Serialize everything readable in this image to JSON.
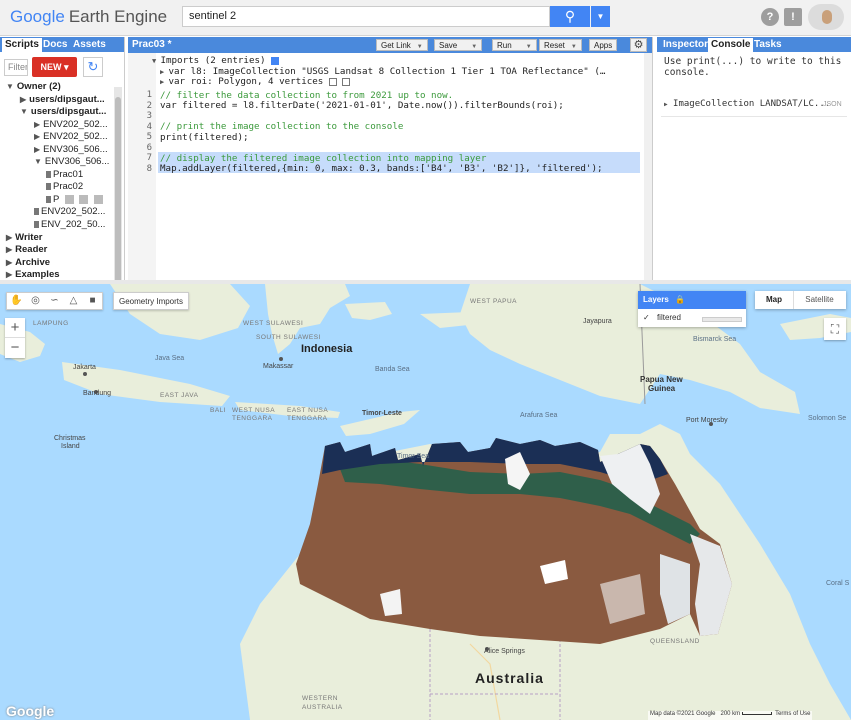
{
  "app": {
    "logo_google": "Google",
    "logo_product": "Earth Engine"
  },
  "search": {
    "value": "sentinel 2",
    "icon": "search-icon"
  },
  "topbar": {
    "help_icon": "?",
    "feedback_icon": "!",
    "apps_icon": "⋮"
  },
  "left_panel": {
    "tabs": [
      "Scripts",
      "Docs",
      "Assets"
    ],
    "filter_placeholder": "Filter",
    "new_label": "NEW",
    "tree": [
      {
        "label": "Owner (2)",
        "bold": true,
        "arrow": "▼"
      },
      {
        "label": "users/dipsgaut...",
        "bold": true,
        "arrow": "▶"
      },
      {
        "label": "users/dipsgaut...",
        "bold": true,
        "arrow": "▼"
      },
      {
        "label": "ENV202_502...",
        "arrow": "▶"
      },
      {
        "label": "ENV202_502...",
        "arrow": "▶"
      },
      {
        "label": "ENV306_506...",
        "arrow": "▶"
      },
      {
        "label": "ENV306_506...",
        "arrow": "▼"
      },
      {
        "label": "Prac01",
        "file": true
      },
      {
        "label": "Prac02",
        "file": true
      },
      {
        "label": "P",
        "file": true
      },
      {
        "label": "ENV202_502...",
        "file": true
      },
      {
        "label": "ENV_202_50...",
        "file": true
      },
      {
        "label": "Writer",
        "bold": true,
        "arrow": "▶"
      },
      {
        "label": "Reader",
        "bold": true,
        "arrow": "▶"
      },
      {
        "label": "Archive",
        "bold": true,
        "arrow": "▶"
      },
      {
        "label": "Examples",
        "bold": true,
        "arrow": "▶"
      }
    ]
  },
  "editor": {
    "title": "Prac03 *",
    "buttons": {
      "get_link": "Get Link",
      "save": "Save",
      "run": "Run",
      "reset": "Reset",
      "apps": "Apps"
    },
    "imports_header": "Imports (2 entries)",
    "imports": [
      "var l8: ImageCollection \"USGS Landsat 8 Collection 1 Tier 1 TOA Reflectance\" (…",
      "var roi: Polygon, 4 vertices"
    ],
    "line_numbers": [
      "1",
      "2",
      "3",
      "4",
      "5",
      "6",
      "7",
      "8"
    ],
    "lines": [
      "// filter the data collection to from 2021 up to now.",
      "var filtered = l8.filterDate('2021-01-01', Date.now()).filterBounds(roi);",
      "",
      "// print the image collection to the console",
      "print(filtered);",
      "",
      "// display the filtered image collection into mapping layer",
      "Map.addLayer(filtered,{min: 0, max: 0.3, bands:['B4', 'B3', 'B2']}, 'filtered');"
    ]
  },
  "right_panel": {
    "tabs": [
      "Inspector",
      "Console",
      "Tasks"
    ],
    "active_tab": "Console",
    "console_hint": "Use print(...) to write to this console.",
    "output_item": "ImageCollection LANDSAT/LC...",
    "json_label": "JSON"
  },
  "map": {
    "geometry_imports": "Geometry Imports",
    "zoom_in": "+",
    "zoom_out": "−",
    "layers_title": "Layers",
    "layer_name": "filtered",
    "map_type_options": [
      "Map",
      "Satellite"
    ],
    "selected_map_type": "Map",
    "labels": {
      "west_papua": "WEST PAPUA",
      "jayapura": "Jayapura",
      "bismarck_sea": "Bismarck Sea",
      "lampung": "LAMPUNG",
      "west_sulawesi": "WEST SULAWESI",
      "south_sulawesi": "SOUTH SULAWESI",
      "indonesia": "Indonesia",
      "java_sea": "Java Sea",
      "jakarta": "Jakarta",
      "makassar": "Makassar",
      "banda_sea": "Banda Sea",
      "papua_new_guinea_1": "Papua New",
      "papua_new_guinea_2": "Guinea",
      "bandung": "Bandung",
      "east_java": "EAST JAVA",
      "bali": "BALI",
      "west_nusa_1": "WEST NUSA",
      "west_nusa_2": "TENGGARA",
      "east_nusa_1": "EAST NUSA",
      "east_nusa_2": "TENGGARA",
      "timor_leste": "Timor-Leste",
      "arafura_sea": "Arafura Sea",
      "port_moresby": "Port Moresby",
      "solomon_sea": "Solomon Se",
      "christmas_1": "Christmas",
      "christmas_2": "Island",
      "timor_sea": "Timor Sea",
      "coral_sea": "Coral S",
      "queensland": "QUEENSLAND",
      "alice_springs": "Alice Springs",
      "australia": "Australia",
      "western_1": "WESTERN",
      "western_2": "AUSTRALIA"
    },
    "google_logo": "Google",
    "attribution": "Map data ©2021 Google",
    "scale": "200 km",
    "terms": "Terms of Use"
  },
  "colors": {
    "blue_bar": "#4a89dc",
    "accent": "#4285f4",
    "new_button": "#d93025",
    "ocean": "#aadaff",
    "land": "#e9eedb"
  }
}
